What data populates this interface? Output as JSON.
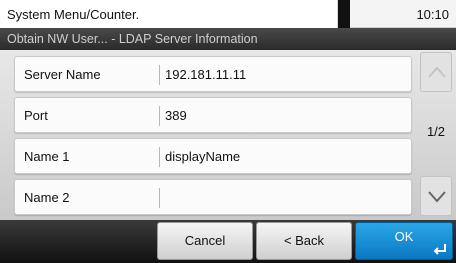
{
  "header": {
    "title": "System Menu/Counter.",
    "time": "10:10",
    "subtitle": "Obtain NW User... - LDAP Server Information"
  },
  "rows": [
    {
      "label": "Server Name",
      "value": "192.181.11.11"
    },
    {
      "label": "Port",
      "value": "389"
    },
    {
      "label": "Name 1",
      "value": "displayName"
    },
    {
      "label": "Name 2",
      "value": ""
    }
  ],
  "pagination": {
    "indicator": "1/2",
    "up_icon": "chevron-up-icon",
    "down_icon": "chevron-down-icon"
  },
  "footer": {
    "cancel_label": "Cancel",
    "back_label": "< Back",
    "ok_label": "OK"
  },
  "colors": {
    "ok_button": "#0a78c3",
    "header_bg": "#2a2a2a"
  }
}
